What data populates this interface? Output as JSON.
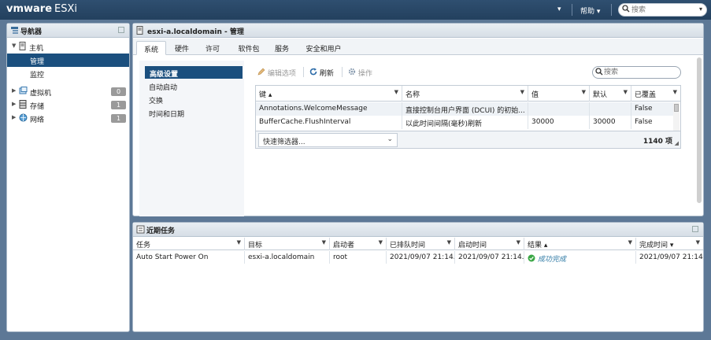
{
  "header": {
    "logo_vm": "vmware",
    "logo_product": "ESXi",
    "user_menu": "▾",
    "help_label": "帮助 ▾",
    "search_placeholder": "搜索"
  },
  "navigator": {
    "title": "导航器",
    "items": [
      {
        "label": "主机",
        "icon": "host-icon"
      },
      {
        "label": "管理",
        "selected": true
      },
      {
        "label": "监控"
      },
      {
        "label": "虚拟机",
        "icon": "vm-icon",
        "count": "0"
      },
      {
        "label": "存储",
        "icon": "storage-icon",
        "count": "1"
      },
      {
        "label": "网络",
        "icon": "network-icon",
        "count": "1"
      }
    ]
  },
  "main": {
    "title": "esxi-a.localdomain - 管理",
    "tabs": [
      "系统",
      "硬件",
      "许可",
      "软件包",
      "服务",
      "安全和用户"
    ],
    "side_menu": [
      "高级设置",
      "自动启动",
      "交换",
      "时间和日期"
    ],
    "toolbar": {
      "edit": "编辑选项",
      "refresh": "刷新",
      "actions": "操作",
      "search_placeholder": "搜索"
    },
    "grid": {
      "columns": [
        "键 ▴",
        "名称",
        "值",
        "默认",
        "已覆盖"
      ],
      "rows": [
        [
          "Annotations.WelcomeMessage",
          "直接控制台用户界面 (DCUI) 的初始...",
          "",
          "",
          "False"
        ],
        [
          "BufferCache.FlushInterval",
          "以此时间间隔(毫秒)刷新",
          "30000",
          "30000",
          "False"
        ]
      ],
      "quick_filter": "快速筛选器...",
      "count": "1140 项"
    }
  },
  "tasks": {
    "title": "近期任务",
    "columns": [
      "任务",
      "目标",
      "启动者",
      "已排队时间",
      "启动时间",
      "结果 ▴",
      "完成时间 ▾"
    ],
    "rows": [
      [
        "Auto Start Power On",
        "esxi-a.localdomain",
        "root",
        "2021/09/07 21:14...",
        "2021/09/07 21:14...",
        "成功完成",
        "2021/09/07 21:14..."
      ]
    ]
  },
  "colors": {
    "topbar": "#2f4f70",
    "selected": "#1b4f7e",
    "background": "#5d7896",
    "success": "#3aa745"
  }
}
